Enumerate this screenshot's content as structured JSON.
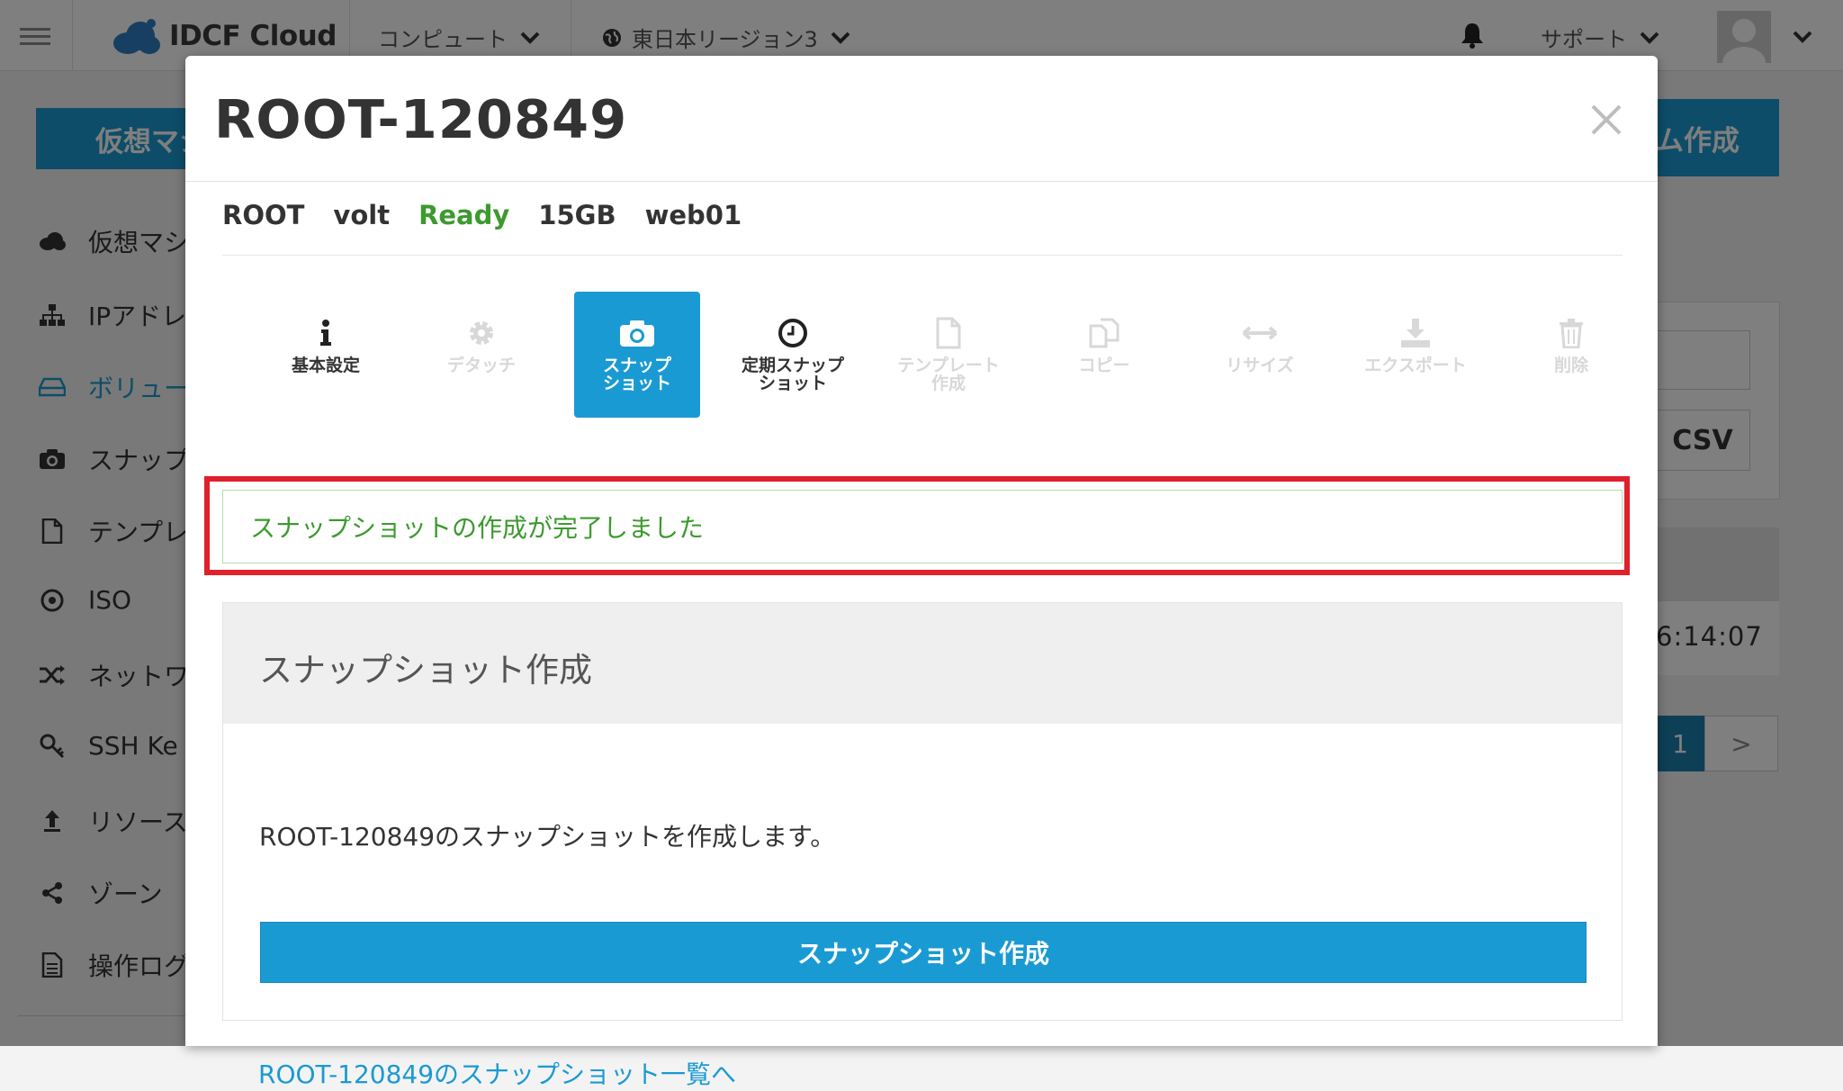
{
  "header": {
    "logo_text": "IDCF Cloud",
    "nav_compute": "コンピュート",
    "nav_region": "東日本リージョン3",
    "nav_support": "サポート"
  },
  "background": {
    "create_vm_button": "仮想マシ",
    "create_system_button": "ム作成",
    "csv_button": "CSV",
    "time_text": "6:14:07",
    "page_current": "1",
    "page_next": ">",
    "sidebar": [
      {
        "label": "仮想マシ",
        "icon": "cloud-icon"
      },
      {
        "label": "IPアドレ",
        "icon": "sitemap-icon"
      },
      {
        "label": "ボリュー",
        "icon": "hdd-icon"
      },
      {
        "label": "スナップ",
        "icon": "camera-icon"
      },
      {
        "label": "テンプレ",
        "icon": "file-icon"
      },
      {
        "label": "ISO",
        "icon": "disc-icon"
      },
      {
        "label": "ネットワ",
        "icon": "shuffle-icon"
      },
      {
        "label": "SSH Ke",
        "icon": "key-icon"
      },
      {
        "label": "リソース",
        "icon": "upload-icon"
      },
      {
        "label": "ゾーン",
        "icon": "share-icon"
      },
      {
        "label": "操作ログ",
        "icon": "log-icon"
      }
    ]
  },
  "modal": {
    "title": "ROOT-120849",
    "info": {
      "type": "ROOT",
      "storage": "volt",
      "status": "Ready",
      "size": "15GB",
      "vm": "web01"
    },
    "tabs": [
      {
        "label": "基本設定",
        "icon": "info-icon"
      },
      {
        "label": "デタッチ",
        "icon": "gear-icon"
      },
      {
        "label": "スナップ\nショット",
        "icon": "camera-icon"
      },
      {
        "label": "定期スナップ\nショット",
        "icon": "clock-icon"
      },
      {
        "label": "テンプレート\n作成",
        "icon": "file-icon"
      },
      {
        "label": "コピー",
        "icon": "copy-icon"
      },
      {
        "label": "リサイズ",
        "icon": "resize-icon"
      },
      {
        "label": "エクスポート",
        "icon": "download-icon"
      },
      {
        "label": "削除",
        "icon": "trash-icon"
      }
    ],
    "alert_text": "スナップショットの作成が完了しました",
    "panel_title": "スナップショット作成",
    "panel_text": "ROOT-120849のスナップショットを作成します。",
    "create_button": "スナップショット作成",
    "list_link": "ROOT-120849のスナップショット一覧へ"
  },
  "colors": {
    "primary": "#1a9ad3",
    "success": "#3c9a2e",
    "highlight": "#e0202a"
  }
}
